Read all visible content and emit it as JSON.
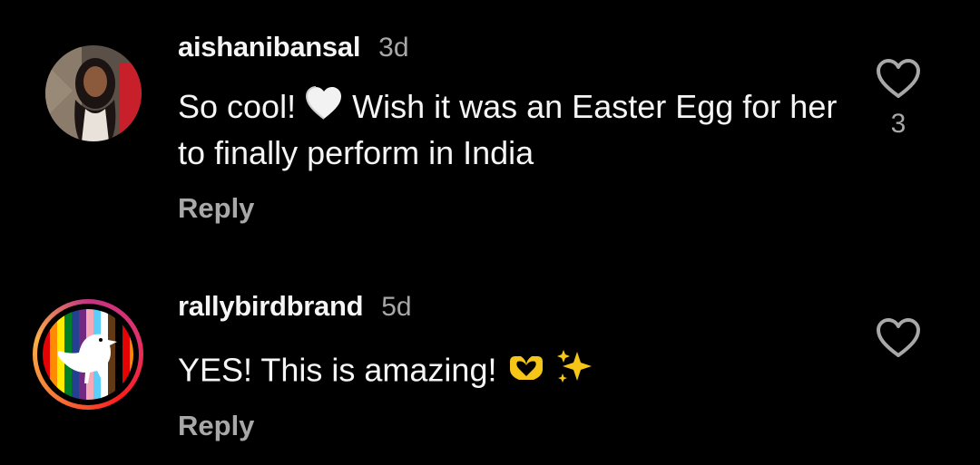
{
  "comments": [
    {
      "username": "aishanibansal",
      "time": "3d",
      "text_before": "So cool!",
      "text_emoji": "white-heart-icon",
      "text_after": "Wish it was an Easter Egg for her to finally perform in India",
      "reply_label": "Reply",
      "likes": "3",
      "avatar": "profile-photo-woman"
    },
    {
      "username": "rallybirdbrand",
      "time": "5d",
      "text": "YES! This is amazing!",
      "emojis": [
        "heart-hands-icon",
        "sparkles-icon"
      ],
      "reply_label": "Reply",
      "avatar": "bird-on-rainbow-stripes",
      "story_ring": true
    }
  ],
  "colors": {
    "background": "#000000",
    "primary_text": "#f5f5f5",
    "secondary_text": "#a8a8a8",
    "heart_gold": "#f5c518"
  }
}
